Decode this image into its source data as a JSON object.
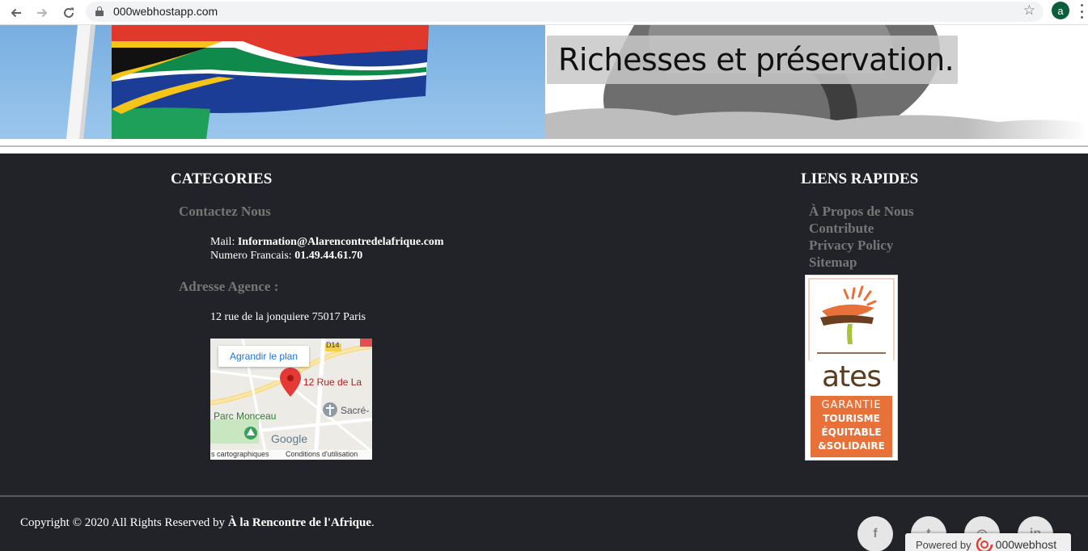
{
  "browser": {
    "url": "000webhostapp.com",
    "profile_initial": "a",
    "icons": [
      "back-arrow-icon",
      "forward-arrow-icon",
      "reload-icon",
      "lock-icon",
      "star-icon",
      "kebab-menu-icon"
    ]
  },
  "banner": {
    "tagline": "Richesses et préservation."
  },
  "footer": {
    "categories": {
      "title": "CATEGORIES",
      "contact_title": "Contactez Nous",
      "mail_label": "Mail:",
      "mail_value": "Information@Alarencontredelafrique.com",
      "phone_label": "Numero Francais:",
      "phone_value": "01.49.44.61.70",
      "address_title": "Adresse Agence :",
      "address_value": "12 rue de la jonquiere 75017 Paris"
    },
    "map": {
      "enlarge_label": "Agrandir le plan",
      "pin_label": "12 Rue de La",
      "park_label": "Parc Monceau",
      "church_label": "Sacré-",
      "road_label": "D14",
      "logo": "Google",
      "data_label": "s cartographiques",
      "terms_label": "Conditions d'utilisation"
    },
    "quick_links": {
      "title": "LIENS RAPIDES",
      "items": [
        "À Propos de Nous",
        "Contribute",
        "Privacy Policy",
        "Sitemap"
      ]
    },
    "ates_badge": {
      "word": "ates",
      "line1": "GARANTIE",
      "line2": "TOURISME",
      "line3": "ÉQUITABLE",
      "line4": "&SOLIDAIRE"
    },
    "copyright_prefix": "Copyright © 2020 All Rights Reserved by",
    "copyright_brand": "À la Rencontre de l'Afrique",
    "copyright_suffix": ".",
    "social": [
      {
        "name": "facebook-icon",
        "glyph": "f"
      },
      {
        "name": "twitter-icon",
        "glyph": "t"
      },
      {
        "name": "dribbble-icon",
        "glyph": "◎"
      },
      {
        "name": "linkedin-icon",
        "glyph": "in"
      }
    ],
    "powered_by": "Powered by",
    "powered_brand": "000webhost"
  },
  "colors": {
    "footer_bg": "#222328",
    "muted_heading": "#767676",
    "ates_orange": "#e8713a",
    "profile_green": "#0b5d3b"
  }
}
